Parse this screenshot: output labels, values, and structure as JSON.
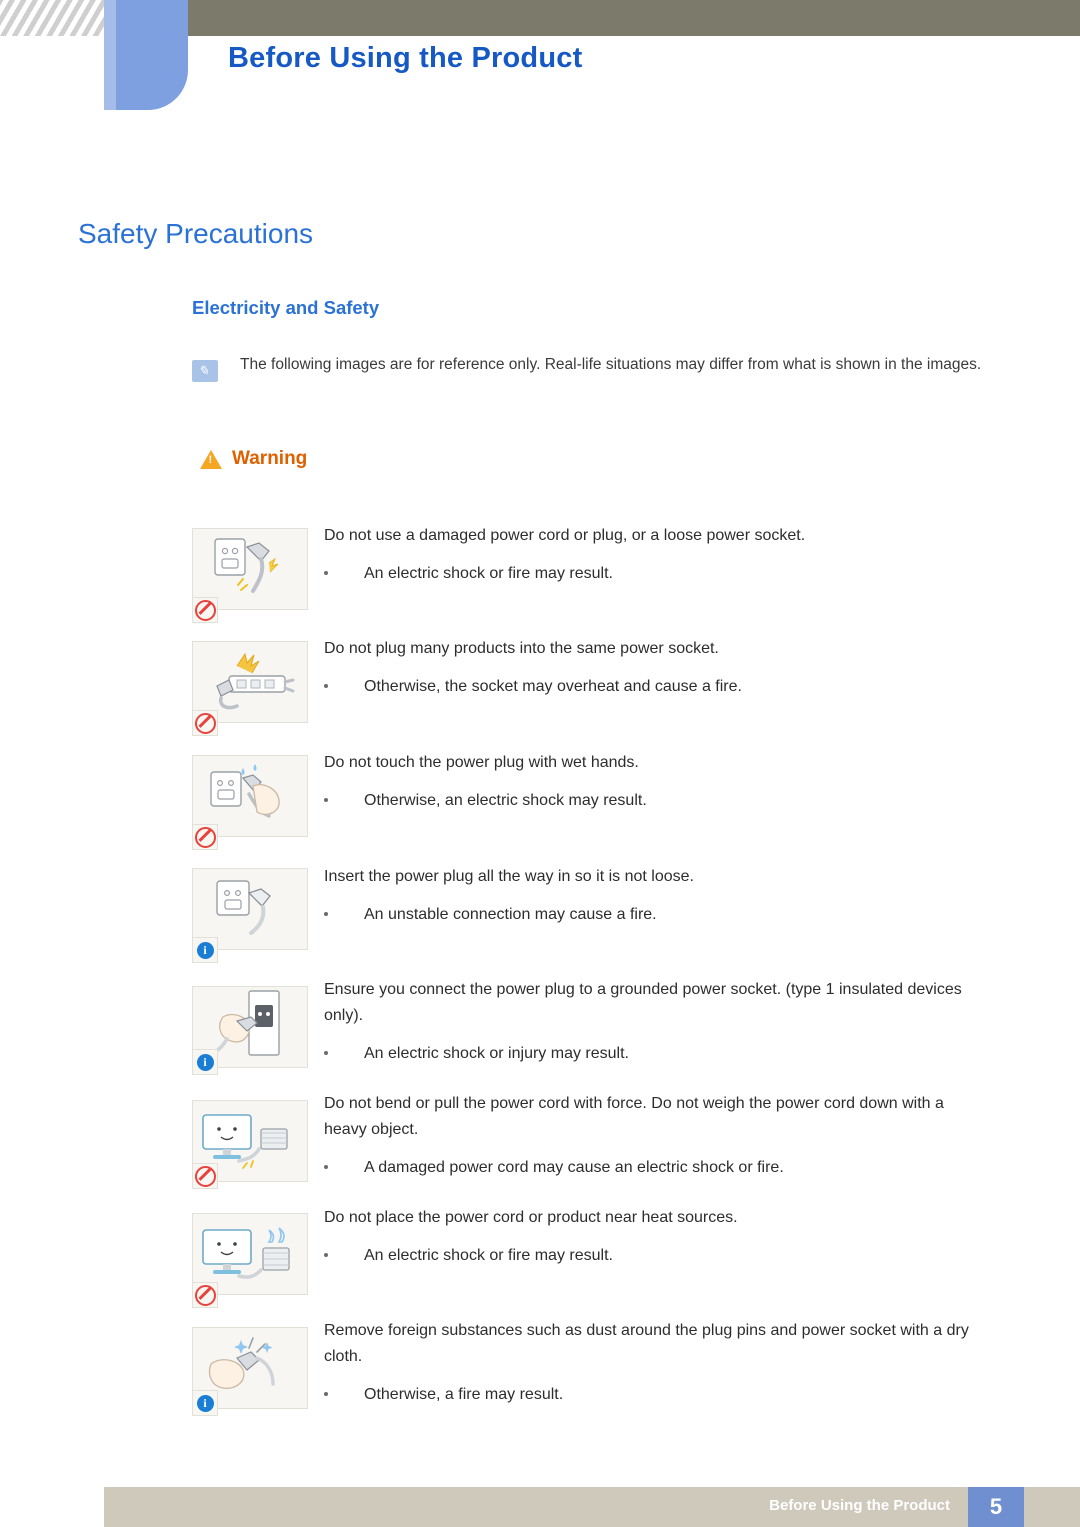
{
  "header": {
    "title": "Before Using the Product"
  },
  "page": {
    "h1": "Safety Precautions",
    "h2": "Electricity and Safety",
    "note": "The following images are for reference only. Real-life situations may differ from what is shown in the images.",
    "warning_label": "Warning"
  },
  "items": [
    {
      "text": "Do not use a damaged power cord or plug, or a loose power socket.",
      "bullet": "An electric shock or fire may result.",
      "badge": "prohibit",
      "icon": "damaged-power-cord-illustration"
    },
    {
      "text": "Do not plug many products into the same power socket.",
      "bullet": "Otherwise, the socket may overheat and cause a fire.",
      "badge": "prohibit",
      "icon": "overloaded-power-strip-illustration"
    },
    {
      "text": "Do not touch the power plug with wet hands.",
      "bullet": "Otherwise, an electric shock may result.",
      "badge": "prohibit",
      "icon": "wet-hands-plug-illustration"
    },
    {
      "text": "Insert the power plug all the way in so it is not loose.",
      "bullet": "An unstable connection may cause a fire.",
      "badge": "info",
      "icon": "insert-plug-fully-illustration"
    },
    {
      "text": "Ensure you connect the power plug to a grounded power socket. (type 1 insulated devices only).",
      "bullet": "An electric shock or injury may result.",
      "badge": "info",
      "icon": "grounded-socket-illustration"
    },
    {
      "text": "Do not bend or pull the power cord with force. Do not weigh the power cord down with a heavy object.",
      "bullet": "A damaged power cord may cause an electric shock or fire.",
      "badge": "prohibit",
      "icon": "bent-power-cord-monitor-illustration"
    },
    {
      "text": "Do not place the power cord or product near heat sources.",
      "bullet": "An electric shock or fire may result.",
      "badge": "prohibit",
      "icon": "heat-source-monitor-illustration"
    },
    {
      "text": "Remove foreign substances such as dust around the plug pins and power socket with a dry cloth.",
      "bullet": "Otherwise, a fire may result.",
      "badge": "info",
      "icon": "clean-plug-pins-illustration"
    }
  ],
  "footer": {
    "text": "Before Using the Product",
    "page_number": "5"
  }
}
